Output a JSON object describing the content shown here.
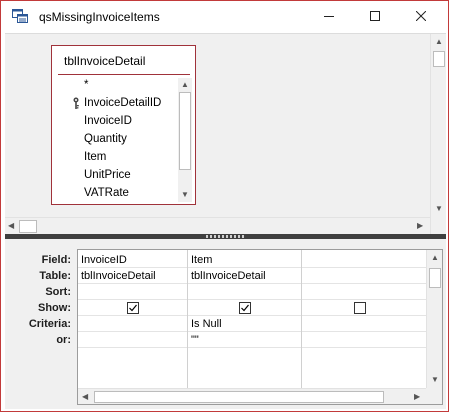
{
  "window": {
    "title": "qsMissingInvoiceItems"
  },
  "table_box": {
    "title": "tblInvoiceDetail",
    "fields": [
      {
        "name": "*",
        "key": false
      },
      {
        "name": "InvoiceDetailID",
        "key": true
      },
      {
        "name": "InvoiceID",
        "key": false
      },
      {
        "name": "Quantity",
        "key": false
      },
      {
        "name": "Item",
        "key": false
      },
      {
        "name": "UnitPrice",
        "key": false
      },
      {
        "name": "VATRate",
        "key": false
      }
    ]
  },
  "grid": {
    "row_labels": [
      "Field:",
      "Table:",
      "Sort:",
      "Show:",
      "Criteria:",
      "or:"
    ],
    "columns": [
      {
        "field": "InvoiceID",
        "table": "tblInvoiceDetail",
        "sort": "",
        "show": true,
        "criteria": "",
        "or": ""
      },
      {
        "field": "Item",
        "table": "tblInvoiceDetail",
        "sort": "",
        "show": true,
        "criteria": "Is Null",
        "or": "\"\""
      },
      {
        "field": "",
        "table": "",
        "sort": "",
        "show": false,
        "criteria": "",
        "or": ""
      }
    ]
  },
  "icons": {
    "app": "query-design-icon",
    "minimize": "minimize-icon",
    "maximize": "maximize-icon",
    "close": "close-icon",
    "primary_key": "key-icon"
  },
  "colors": {
    "window_border": "#c23a3a",
    "table_border": "#a0323a",
    "pane_background": "#f0f0f0",
    "splitter": "#3f3f3f"
  }
}
